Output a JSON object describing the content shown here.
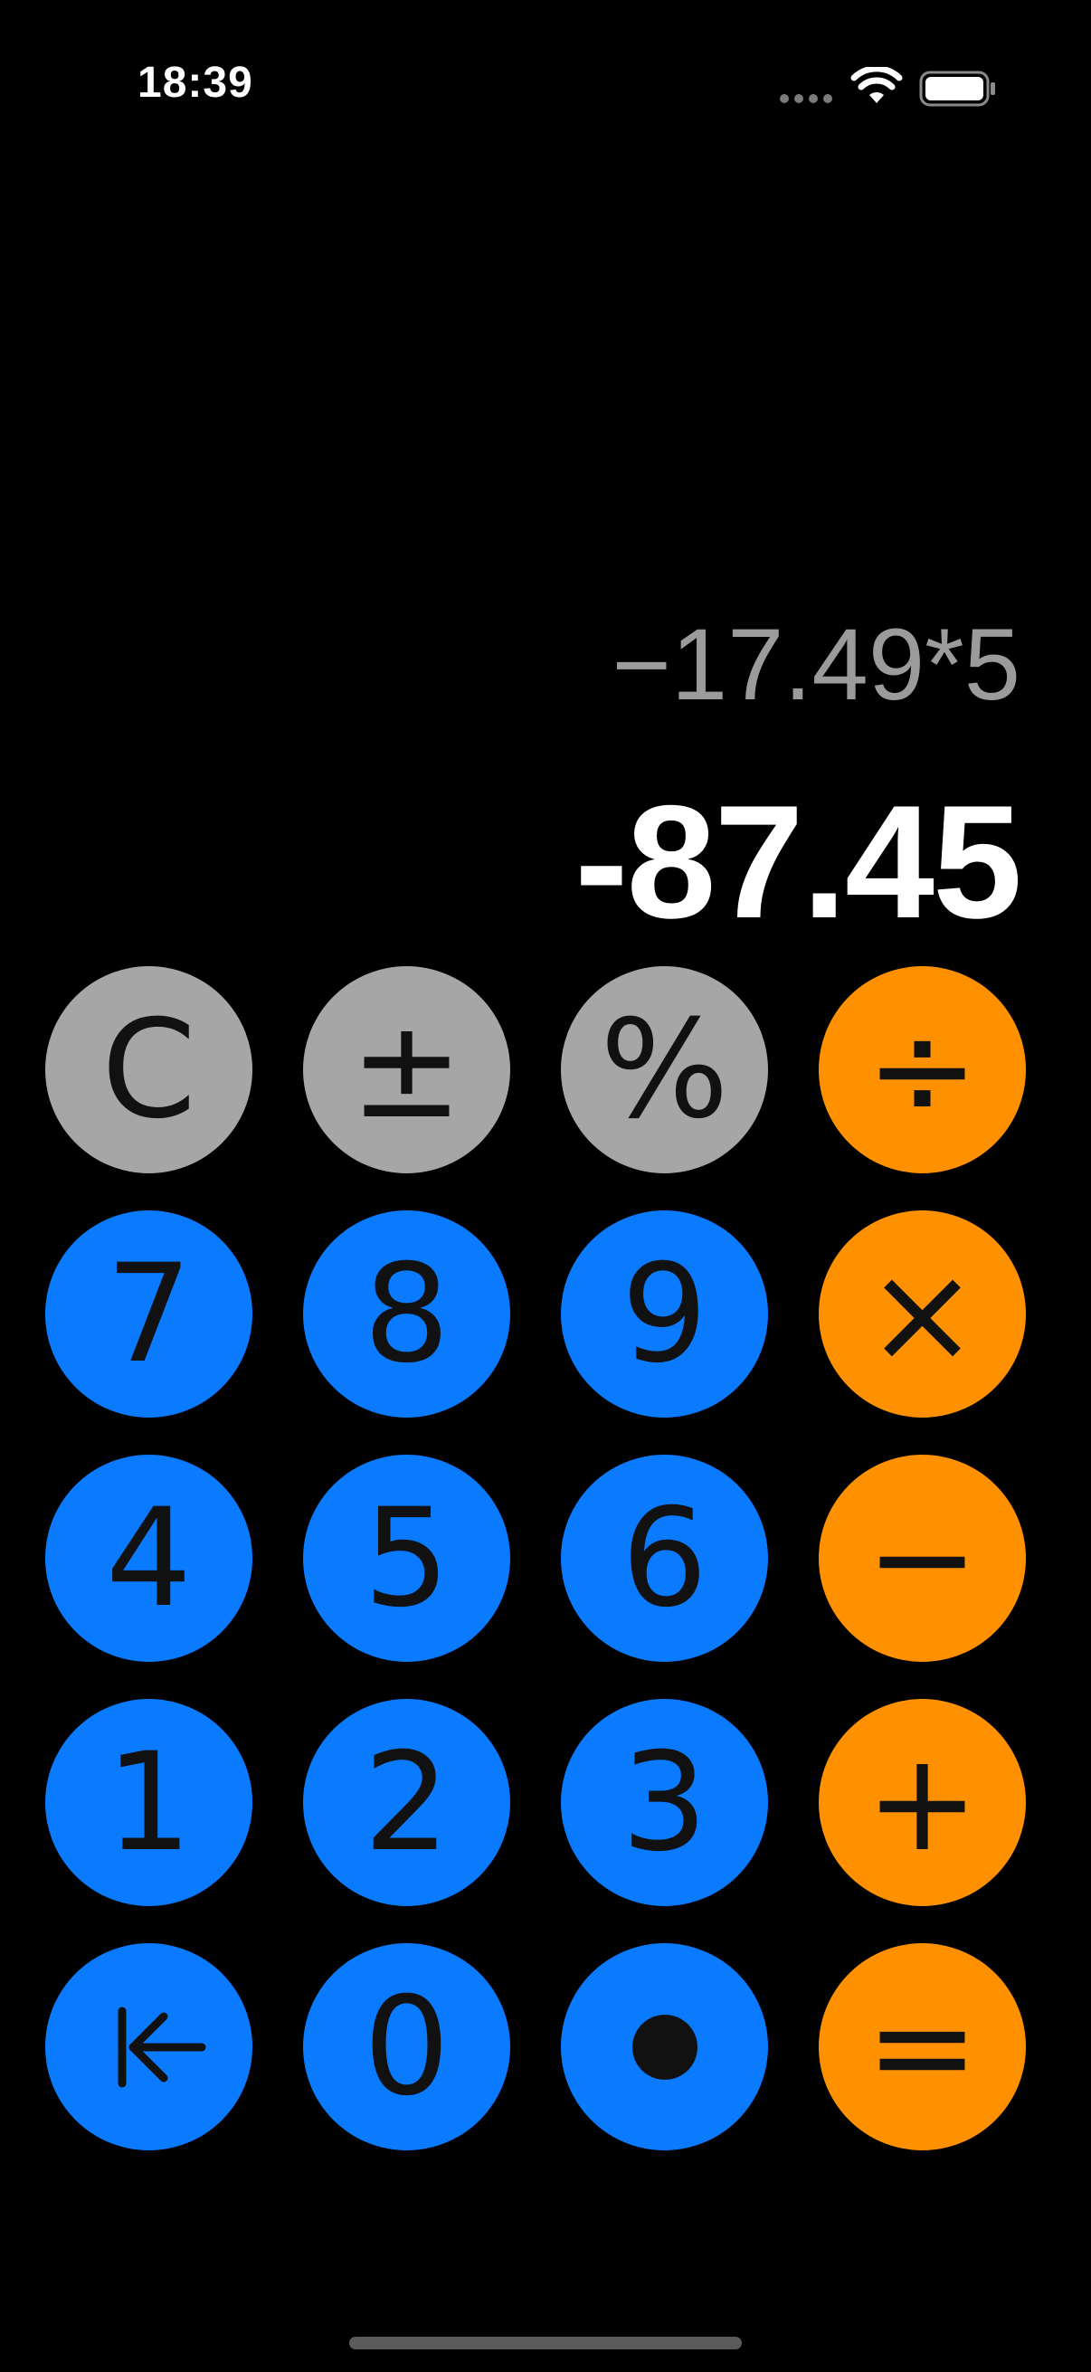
{
  "status_bar": {
    "time": "18:39",
    "wifi_icon": "wifi-icon",
    "battery_icon": "battery-icon"
  },
  "display": {
    "expression": "−17.49*5",
    "result": "-87.45"
  },
  "keys": {
    "clear": "C",
    "plus_minus": "±",
    "percent": "%",
    "divide": "÷",
    "seven": "7",
    "eight": "8",
    "nine": "9",
    "multiply": "×",
    "four": "4",
    "five": "5",
    "six": "6",
    "minus": "−",
    "one": "1",
    "two": "2",
    "three": "3",
    "plus": "+",
    "backspace_icon": "arrow-left-to-bar-icon",
    "zero": "0",
    "decimal_icon": "dot-icon",
    "equals": "="
  },
  "colors": {
    "function_key": "#a6a6a6",
    "digit_key": "#0a7aff",
    "operator_key": "#ff9100",
    "background": "#000000",
    "expression_text": "#9b9b9b",
    "result_text": "#ffffff"
  }
}
